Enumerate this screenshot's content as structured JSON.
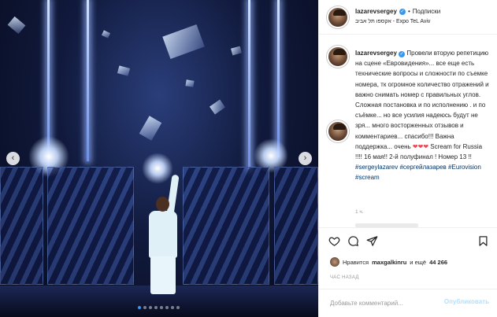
{
  "post": {
    "username": "lazarevsergey",
    "separator": "•",
    "follow_label": "Подписки",
    "location": "אקספו תל אביב - Expo TeL Aviv"
  },
  "caption": {
    "username": "lazarevsergey",
    "text_1": "Провели вторую репетицию на сцене «Евровидения»... все еще есть технические вопросы и сложности по съемке номера, тк огромное количество отражений и важно снимать номер с правильных углов. Сложная постановка и по исполнению . и по съёмке... но все усилия надеюсь будут не зря... много восторженных отзывов и комментариев... спасибо!!! Важна поддержка... очень",
    "hearts": "❤❤❤",
    "text_2": "Scream for Russia !!!! 16 мая!! 2-й полуфинал ! Номер 13 !!",
    "hashtags": [
      "#sergeylazarev",
      "#сергейлазарев",
      "#Eurovision",
      "#scream"
    ],
    "time_ago": "1 ч."
  },
  "likes": {
    "prefix": "Нравится",
    "user": "maxgalkinru",
    "middle": "и ещё",
    "count": "44 266"
  },
  "posted_time": "ЧАС НАЗАД",
  "comment_box": {
    "placeholder": "Добавьте комментарий...",
    "publish_label": "Опубликовать"
  },
  "carousel": {
    "total": 8,
    "active_index": 0
  },
  "colors": {
    "accent": "#3897f0",
    "heart": "#ed4956",
    "hashtag": "#003569"
  },
  "icons": [
    "heart-icon",
    "comment-icon",
    "share-icon",
    "bookmark-icon",
    "verified-icon",
    "chevron-left-icon",
    "chevron-right-icon"
  ]
}
